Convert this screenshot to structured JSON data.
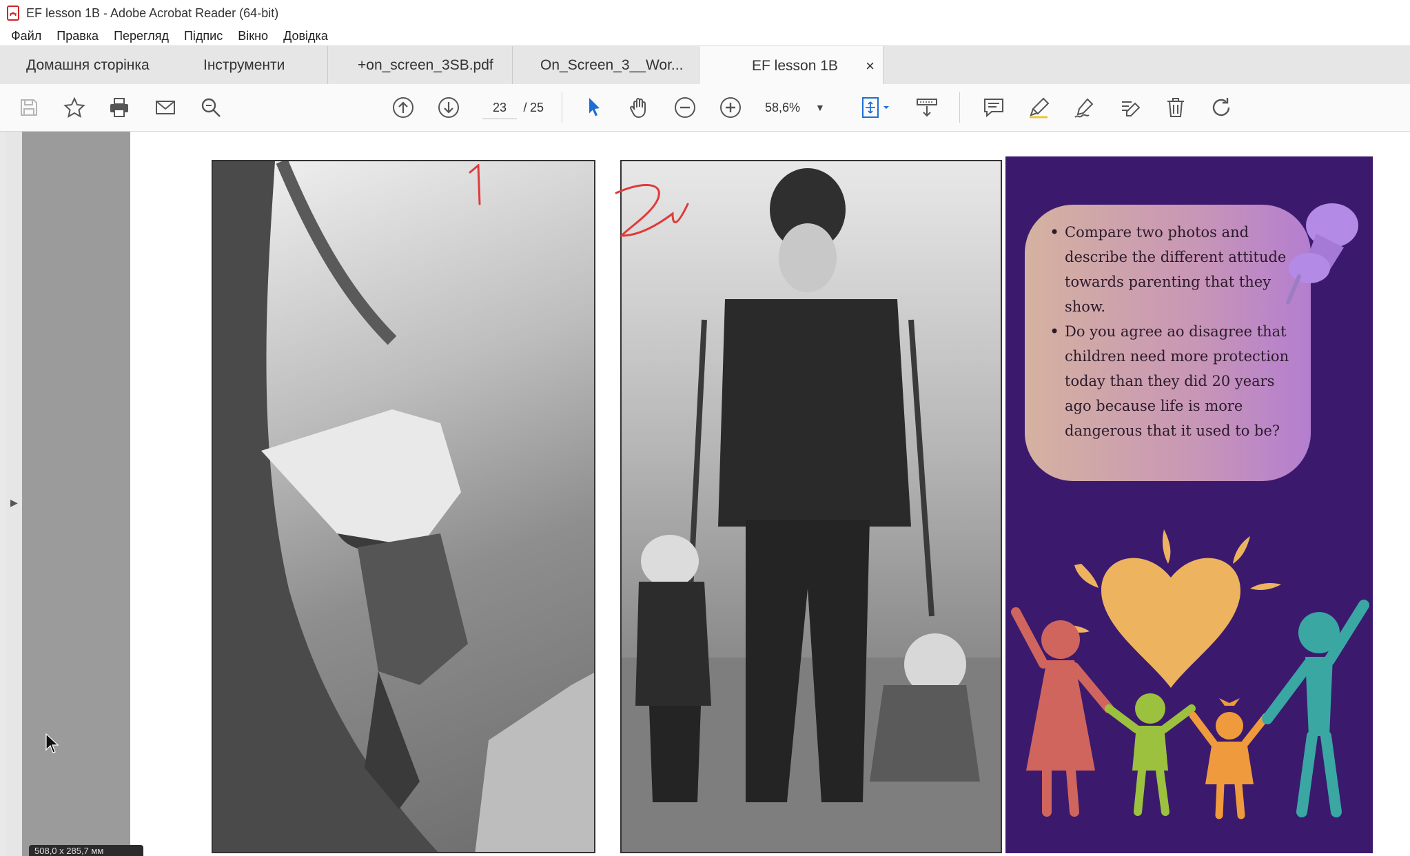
{
  "window": {
    "title": "EF lesson 1B - Adobe Acrobat Reader (64-bit)"
  },
  "menu": {
    "items": [
      "Файл",
      "Правка",
      "Перегляд",
      "Підпис",
      "Вікно",
      "Довідка"
    ]
  },
  "tabs": {
    "home": "Домашня сторінка",
    "tools": "Інструменти",
    "docs": [
      "+on_screen_3SB.pdf",
      "On_Screen_3__Wor...",
      "EF lesson 1B"
    ],
    "close_glyph": "×"
  },
  "toolbar": {
    "page_current": "23",
    "page_separator": "/",
    "page_total": "25",
    "zoom": "58,6%"
  },
  "status": {
    "coords": "508,0 x 285,7 мм"
  },
  "document": {
    "annotations": {
      "mark1": "1",
      "mark2": "2"
    },
    "card": {
      "bullets": [
        "Compare two photos and describe the different attitude towards parenting that they show.",
        "Do you agree ao disagree that children need more protection today than they did 20 years ago because life is more dangerous that it used to be?"
      ],
      "colors": {
        "background": "#3b1a6e",
        "heart": "#edb35e",
        "figure_left": "#d0655e",
        "figure_green": "#9cc13e",
        "figure_orange": "#ef9a3c",
        "figure_teal": "#3aa7a3",
        "pin": "#b38ae6"
      }
    }
  },
  "colors": {
    "annotation_red": "#e03a3a",
    "workarea": "#ffffff",
    "nav_gray": "#9b9b9b"
  }
}
